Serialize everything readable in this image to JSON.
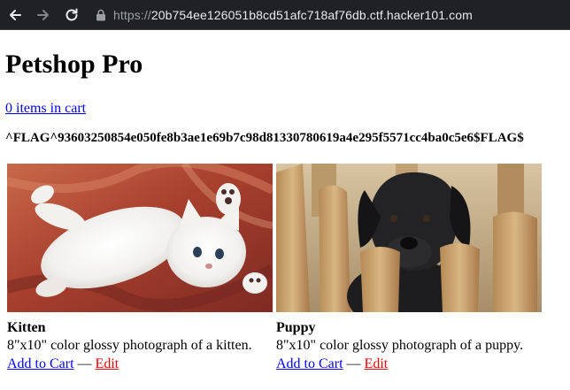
{
  "browser": {
    "url_scheme": "https://",
    "url_host": "20b754ee126051b8cd51afc718af76db.ctf.hacker101.com",
    "back_icon": "arrow-left-icon",
    "forward_icon": "arrow-right-icon",
    "reload_icon": "reload-icon",
    "lock_icon": "lock-icon"
  },
  "page": {
    "title": "Petshop Pro",
    "cart_link": "0 items in cart",
    "flag": "^FLAG^93603250854e050fe8b3ae1e69b7c98d81330780619a4e295f5571cc4ba0c5e6$FLAG$"
  },
  "products": [
    {
      "name": "Kitten",
      "description": "8\"x10\" color glossy photograph of a kitten.",
      "add_label": "Add to Cart",
      "separator": "—",
      "edit_label": "Edit"
    },
    {
      "name": "Puppy",
      "description": "8\"x10\" color glossy photograph of a puppy.",
      "add_label": "Add to Cart",
      "separator": "—",
      "edit_label": "Edit"
    }
  ],
  "colors": {
    "chrome_bg": "#202124",
    "link": "#0000ee",
    "edit_link": "#ee0000"
  }
}
